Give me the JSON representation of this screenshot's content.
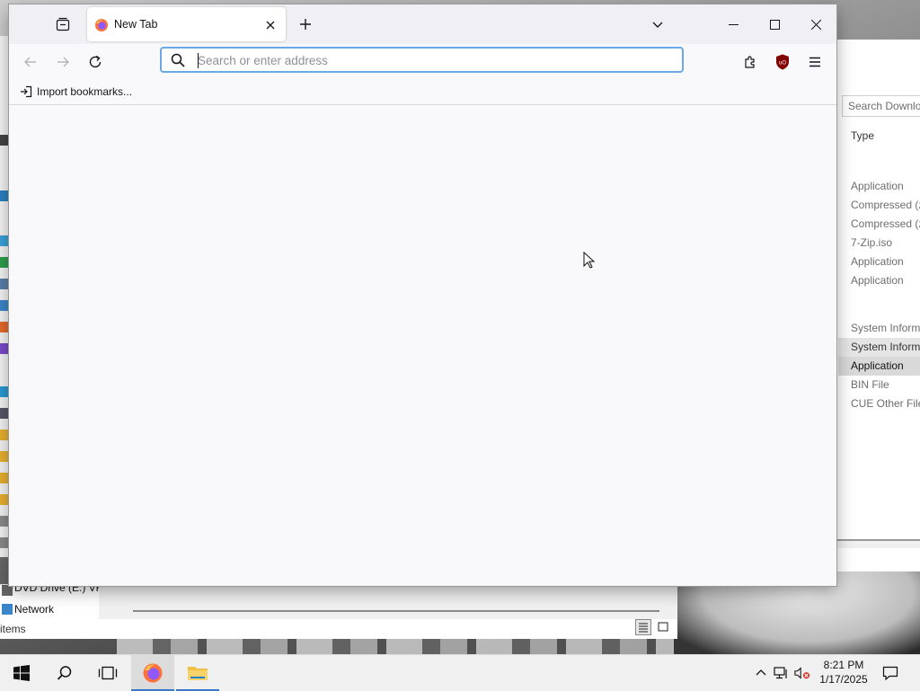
{
  "firefox": {
    "tab": {
      "title": "New Tab"
    },
    "urlbar": {
      "placeholder": "Search or enter address",
      "value": ""
    },
    "bookmarks": {
      "import_label": "Import bookmarks..."
    }
  },
  "explorer_right": {
    "search_placeholder": "Search Downloads",
    "column_header": "Type",
    "rows": [
      "Application",
      "Compressed (zipped) Folder",
      "Compressed (zipped) Folder",
      "7-Zip.iso",
      "Application",
      "Application",
      "System Information File",
      "System Information File",
      "Application",
      "BIN File",
      "CUE Other File"
    ]
  },
  "explorer_left": {
    "nav": [
      "DVD Drive (E:) VFF",
      "Network"
    ],
    "status": "items"
  },
  "taskbar": {
    "time": "8:21 PM",
    "date": "1/17/2025"
  },
  "colors": {
    "accent": "#3a78c9",
    "urlbar_focus": "#6aa8e8",
    "ublock": "#800000"
  }
}
